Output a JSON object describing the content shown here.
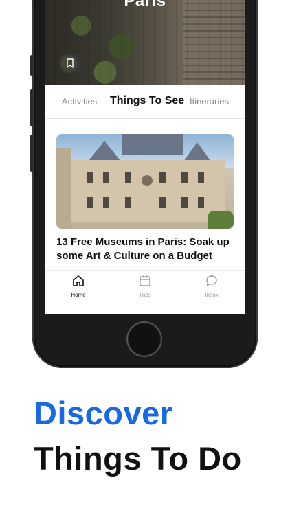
{
  "hero": {
    "title": "Paris"
  },
  "tabs": [
    {
      "label": "Activities"
    },
    {
      "label": "Things To See"
    },
    {
      "label": "Itineraries"
    }
  ],
  "card": {
    "title": "13 Free Museums in Paris: Soak up some Art & Culture on a Budget"
  },
  "tabbar": {
    "items": [
      {
        "label": "Home",
        "icon": "home-icon"
      },
      {
        "label": "Trips",
        "icon": "calendar-icon"
      },
      {
        "label": "Inbox",
        "icon": "chat-bubble-icon"
      }
    ]
  },
  "headline": {
    "line1": "Discover",
    "line2": "Things To Do"
  },
  "colors": {
    "accent": "#1668e3",
    "text": "#111111",
    "inactive": "#8a8a8a"
  }
}
